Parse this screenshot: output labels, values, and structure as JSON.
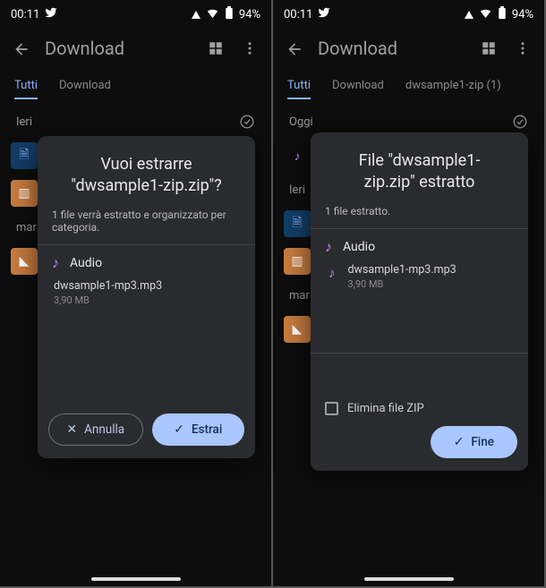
{
  "status": {
    "time": "00:11",
    "battery": "94%"
  },
  "appbar": {
    "title": "Download"
  },
  "left": {
    "tabs": {
      "all": "Tutti",
      "download": "Download"
    },
    "sections": {
      "s1": "Ieri",
      "s2": "mar"
    },
    "dialog": {
      "title": "Vuoi estrarre \"dwsample1-zip.zip\"?",
      "subtitle": "1 file verrà estratto e organizzato per categoria.",
      "category": "Audio",
      "file_name": "dwsample1-mp3.mp3",
      "file_size": "3,90 MB",
      "cancel": "Annulla",
      "confirm": "Estrai"
    }
  },
  "right": {
    "tabs": {
      "all": "Tutti",
      "download": "Download",
      "crumb": "dwsample1-zip (1)"
    },
    "sections": {
      "s0": "Oggi",
      "s1": "Ieri",
      "s2": "mar"
    },
    "dialog": {
      "title": "File \"dwsample1-zip.zip\" estratto",
      "subtitle": "1 file estratto.",
      "category": "Audio",
      "file_name": "dwsample1-mp3.mp3",
      "file_size": "3,90 MB",
      "delete_zip": "Elimina file ZIP",
      "done": "Fine"
    }
  }
}
